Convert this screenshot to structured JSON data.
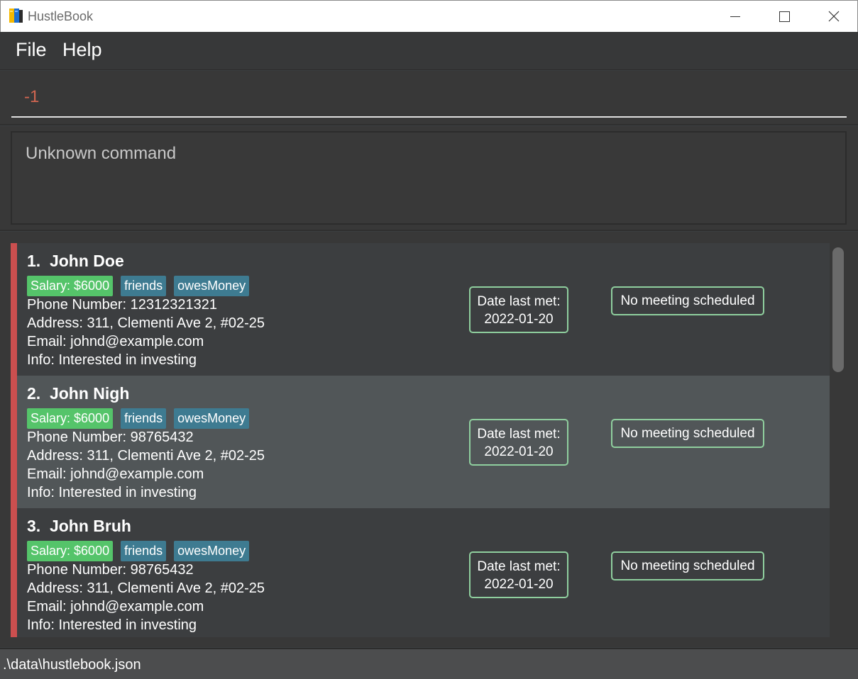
{
  "window": {
    "title": "HustleBook"
  },
  "menu": {
    "file": "File",
    "help": "Help"
  },
  "command": {
    "value": "-1"
  },
  "result": {
    "text": "Unknown command"
  },
  "persons": [
    {
      "index": "1.",
      "name": "John Doe",
      "salary": "Salary: $6000",
      "tags": [
        "friends",
        "owesMoney"
      ],
      "phone": "Phone Number: 12312321321",
      "address": "Address: 311, Clementi Ave 2, #02-25",
      "email": "Email: johnd@example.com",
      "info": "Info: Interested in investing",
      "date_label": "Date last met:",
      "date_value": "2022-01-20",
      "meeting": "No meeting scheduled"
    },
    {
      "index": "2.",
      "name": "John Nigh",
      "salary": "Salary: $6000",
      "tags": [
        "friends",
        "owesMoney"
      ],
      "phone": "Phone Number: 98765432",
      "address": "Address: 311, Clementi Ave 2, #02-25",
      "email": "Email: johnd@example.com",
      "info": "Info: Interested in investing",
      "date_label": "Date last met:",
      "date_value": "2022-01-20",
      "meeting": "No meeting scheduled"
    },
    {
      "index": "3.",
      "name": "John Bruh",
      "salary": "Salary: $6000",
      "tags": [
        "friends",
        "owesMoney"
      ],
      "phone": "Phone Number: 98765432",
      "address": "Address: 311, Clementi Ave 2, #02-25",
      "email": "Email: johnd@example.com",
      "info": "Info: Interested in investing",
      "date_label": "Date last met:",
      "date_value": "2022-01-20",
      "meeting": "No meeting scheduled"
    }
  ],
  "status": {
    "path": ".\\data\\hustlebook.json"
  },
  "colors": {
    "accent_bar": "#cb4f4f",
    "salary_tag": "#55c46a",
    "tag": "#3e7b91",
    "command_text": "#d06651",
    "box_border": "#8fcf9e"
  },
  "icons": {
    "app": "book-icon",
    "minimize": "minimize-icon",
    "maximize": "maximize-icon",
    "close": "close-icon"
  }
}
